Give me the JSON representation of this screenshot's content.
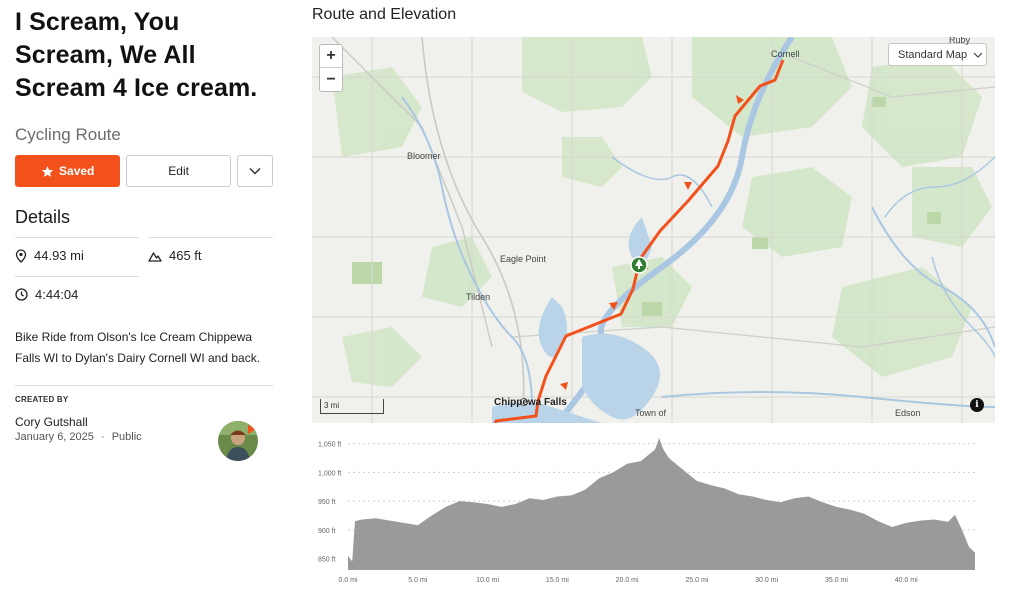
{
  "route": {
    "title": "I Scream, You Scream, We All Scream 4 Ice cream.",
    "type": "Cycling Route",
    "saved_label": "Saved",
    "edit_label": "Edit",
    "details_heading": "Details",
    "distance": "44.93 mi",
    "elevation_gain": "465 ft",
    "duration": "4:44:04",
    "description": "Bike Ride from Olson's Ice Cream Chippewa Falls WI to Dylan's Dairy Cornell WI and back.",
    "created_by_label": "CREATED BY",
    "author": "Cory Gutshall",
    "date": "January 6, 2025",
    "visibility": "Public",
    "separator": "·"
  },
  "colors": {
    "accent": "#f2511b",
    "route_line": "#f2511b",
    "water": "#b9d3e8",
    "green": "#cfe3c4",
    "elevation_fill": "#9a9a9a"
  },
  "map": {
    "section_title": "Route and Elevation",
    "zoom_in": "+",
    "zoom_out": "−",
    "map_type": "Standard Map",
    "scale_label": "3 mi",
    "info": "i",
    "places": {
      "ruby": "Ruby",
      "cornell": "Cornell",
      "bloomer": "Bloomer",
      "eagle_point": "Eagle Point",
      "tilden": "Tilden",
      "chippewa_falls": "Chippewa Falls",
      "town_of": "Town of",
      "edson": "Edson"
    }
  },
  "elevation": {
    "y_ticks": [
      "1,050 ft",
      "1,000 ft",
      "950 ft",
      "900 ft",
      "850 ft"
    ],
    "x_ticks": [
      "0.0 mi",
      "5.0 mi",
      "10.0 mi",
      "15.0 mi",
      "20.0 mi",
      "25.0 mi",
      "30.0 mi",
      "35.0 mi",
      "40.0 mi"
    ]
  },
  "chart_data": {
    "type": "area",
    "title": "",
    "xlabel": "",
    "ylabel": "",
    "xlim": [
      0,
      44.93
    ],
    "ylim": [
      830,
      1060
    ],
    "x": [
      0,
      0.3,
      0.5,
      1,
      2,
      3,
      4,
      5,
      6,
      7,
      8,
      9,
      10,
      11,
      12,
      13,
      14,
      15,
      16,
      17,
      18,
      19,
      20,
      21,
      21.5,
      22,
      22.3,
      22.6,
      23,
      24,
      25,
      26,
      27,
      28,
      29,
      30,
      31,
      32,
      33,
      34,
      35,
      36,
      37,
      38,
      39,
      40,
      41,
      42,
      43,
      43.5,
      44,
      44.5,
      44.93
    ],
    "y": [
      855,
      845,
      915,
      918,
      920,
      916,
      912,
      908,
      925,
      940,
      950,
      948,
      945,
      940,
      945,
      955,
      952,
      958,
      960,
      970,
      990,
      1000,
      1015,
      1020,
      1030,
      1040,
      1060,
      1040,
      1025,
      1005,
      985,
      978,
      972,
      962,
      958,
      952,
      948,
      955,
      958,
      948,
      940,
      935,
      928,
      915,
      905,
      912,
      916,
      918,
      914,
      926,
      900,
      870,
      860
    ]
  }
}
